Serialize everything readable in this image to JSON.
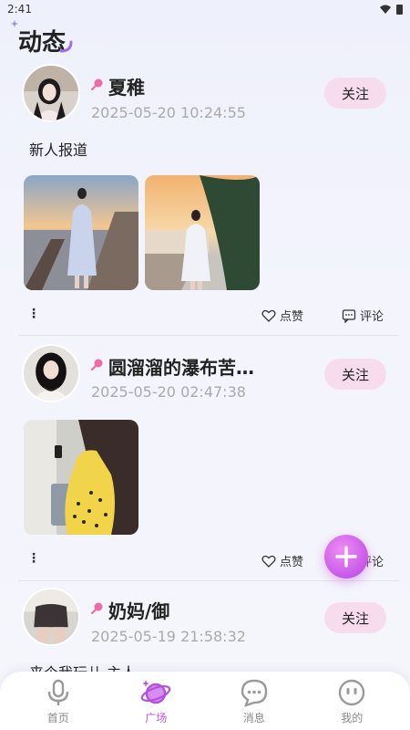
{
  "status_bar": {
    "time": "2:41"
  },
  "page": {
    "title": "动态"
  },
  "posts": [
    {
      "username": "夏稚",
      "timestamp": "2025-05-20 10:24:55",
      "follow_label": "关注",
      "text": "新人报道",
      "like_label": "点赞",
      "comment_label": "评论",
      "photo_count": 2
    },
    {
      "username": "圆溜溜的瀑布苦…",
      "timestamp": "2025-05-20 02:47:38",
      "follow_label": "关注",
      "text": "",
      "like_label": "点赞",
      "comment_label": "评论",
      "photo_count": 1
    },
    {
      "username": "奶妈/御",
      "timestamp": "2025-05-19 21:58:32",
      "follow_label": "关注",
      "text": "来个我玩儿 主人"
    }
  ],
  "tab_bar": {
    "items": [
      {
        "label": "首页",
        "icon": "mic-icon"
      },
      {
        "label": "广场",
        "icon": "planet-icon",
        "active": true
      },
      {
        "label": "消息",
        "icon": "chat-bubble-icon"
      },
      {
        "label": "我的",
        "icon": "face-icon"
      }
    ]
  },
  "colors": {
    "accent": "#c052e6",
    "follow_bg": "#f7dcee",
    "gender_female": "#f06aa8"
  }
}
